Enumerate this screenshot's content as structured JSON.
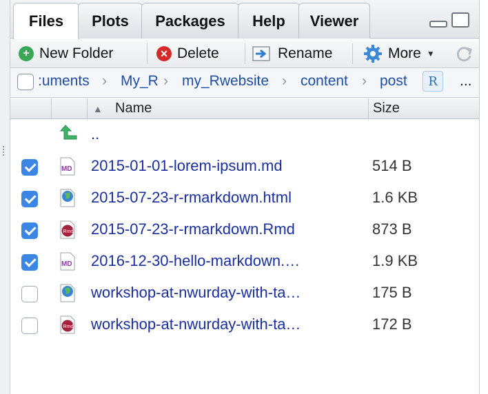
{
  "tabs": [
    "Files",
    "Plots",
    "Packages",
    "Help",
    "Viewer"
  ],
  "toolbar": {
    "new_folder": "New Folder",
    "delete": "Delete",
    "rename": "Rename",
    "more": "More"
  },
  "breadcrumb": [
    ":uments",
    "My_R",
    "my_Rwebsite",
    "content",
    "post"
  ],
  "breadcrumb_more": "...",
  "columns": {
    "name": "Name",
    "size": "Size"
  },
  "up_label": "..",
  "files": [
    {
      "name": "2015-01-01-lorem-ipsum.md",
      "size": "514 B",
      "checked": true,
      "icon": "markdown-file-icon"
    },
    {
      "name": "2015-07-23-r-rmarkdown.html",
      "size": "1.6 KB",
      "checked": true,
      "icon": "html-file-icon"
    },
    {
      "name": "2015-07-23-r-rmarkdown.Rmd",
      "size": "873 B",
      "checked": true,
      "icon": "rmd-file-icon"
    },
    {
      "name": "2016-12-30-hello-markdown.…",
      "size": "1.9 KB",
      "checked": true,
      "icon": "markdown-file-icon"
    },
    {
      "name": "workshop-at-nwurday-with-ta…",
      "size": "175 B",
      "checked": false,
      "icon": "html-file-icon"
    },
    {
      "name": "workshop-at-nwurday-with-ta…",
      "size": "172 B",
      "checked": false,
      "icon": "rmd-file-icon"
    }
  ],
  "colors": {
    "link": "#1a2f9e",
    "checkbox": "#3b86e4",
    "crumb": "#1f4fa5"
  }
}
